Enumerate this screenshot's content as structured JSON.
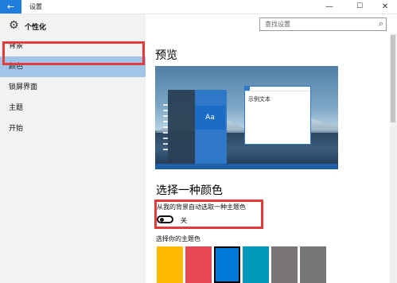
{
  "window": {
    "back_icon": "back-arrow-icon",
    "title": "设置",
    "controls": {
      "minimize": "—",
      "maximize": "☐",
      "close": "✕"
    }
  },
  "sidebar": {
    "header_icon": "gear-icon",
    "header_title": "个性化",
    "items": [
      {
        "label": "背景",
        "selected": false
      },
      {
        "label": "颜色",
        "selected": true
      },
      {
        "label": "锁屏界面",
        "selected": false
      },
      {
        "label": "主题",
        "selected": false
      },
      {
        "label": "开始",
        "selected": false
      }
    ]
  },
  "search": {
    "placeholder": "查找设置",
    "icon": "search-icon"
  },
  "preview": {
    "title": "预览",
    "tile_label": "Aa",
    "sample_window_text": "示例文本"
  },
  "color_section": {
    "title": "选择一种颜色",
    "auto_pick_label": "从我的背景自动选取一种主题色",
    "toggle_state": "关",
    "toggle_on": false,
    "palette_label": "选择你的主题色",
    "swatches": [
      "#ffb900",
      "#e74856",
      "#0078d7",
      "#0099bc",
      "#7a7574",
      "#767676"
    ],
    "selected_swatch": 2
  },
  "colors": {
    "accent": "#0078d7",
    "sidebar_selected": "#9fc6e8",
    "highlight_frame": "#e23b3b"
  }
}
